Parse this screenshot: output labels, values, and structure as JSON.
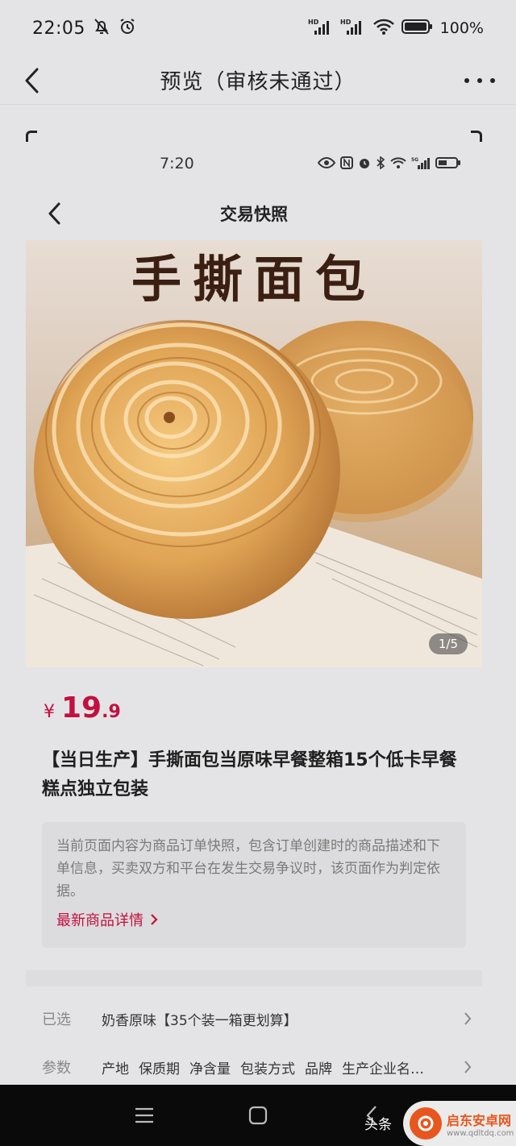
{
  "status_bar": {
    "time": "22:05",
    "battery": "100%",
    "icons": [
      "mute-bell-icon",
      "alarm-icon",
      "hd-signal-icon",
      "hd-signal-icon",
      "wifi-icon",
      "battery-icon"
    ]
  },
  "header": {
    "title": "预览（审核未通过）"
  },
  "preview": {
    "status_bar": {
      "time": "7:20",
      "icons": [
        "eye-icon",
        "nfc-icon",
        "alarm-icon",
        "bluetooth-icon",
        "wifi-icon",
        "5g-signal-icon",
        "battery-icon"
      ]
    },
    "page_title": "交易快照",
    "image": {
      "caption": "手撕面包",
      "counter": "1/5"
    },
    "price": {
      "currency": "¥",
      "integer": "19",
      "decimal": ".9"
    },
    "product_title": "【当日生产】手撕面包当原味早餐整箱15个低卡早餐糕点独立包装",
    "notice": {
      "text": "当前页面内容为商品订单快照，包含订单创建时的商品描述和下单信息，买卖双方和平台在发生交易争议时，该页面作为判定依据。",
      "link": "最新商品详情"
    },
    "selected": {
      "label": "已选",
      "value": "奶香原味【35个装一箱更划算】"
    },
    "params": {
      "label": "参数",
      "items": [
        "产地",
        "保质期",
        "净含量",
        "包装方式",
        "品牌",
        "生产企业名…"
      ]
    }
  },
  "watermark": {
    "source": "头条",
    "site_name": "启东安卓网",
    "site_url": "www.qdltdq.com"
  },
  "colors": {
    "accent": "#c2103f",
    "background": "#e4e4e6",
    "nav_bar": "#0a0a0a"
  }
}
